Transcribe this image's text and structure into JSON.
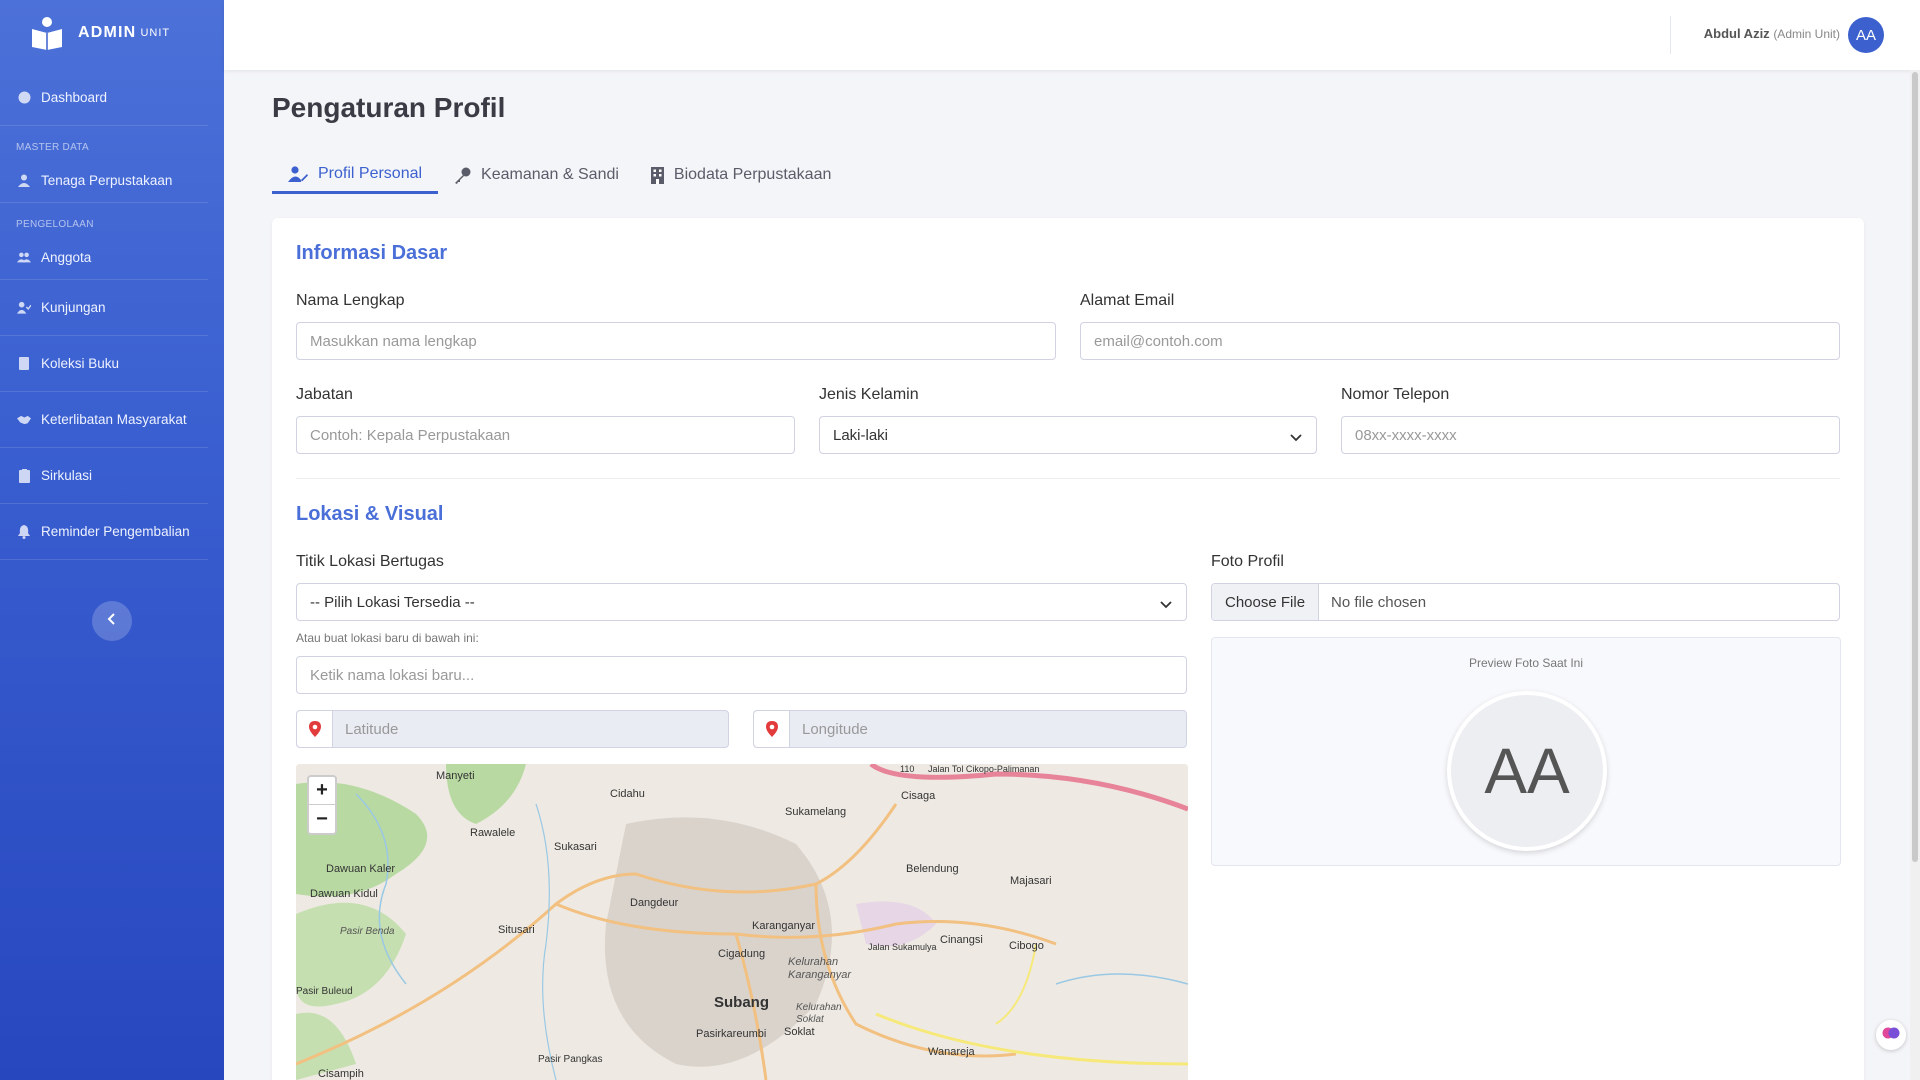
{
  "brand": {
    "name": "ADMIN",
    "sup": "UNIT"
  },
  "sidebar": {
    "dashboard": "Dashboard",
    "heading_master": "MASTER DATA",
    "tenaga": "Tenaga Perpustakaan",
    "heading_pengelolaan": "PENGELOLAAN",
    "items": [
      "Anggota",
      "Kunjungan",
      "Koleksi Buku",
      "Keterlibatan Masyarakat",
      "Sirkulasi",
      "Reminder Pengembalian"
    ]
  },
  "topbar": {
    "user_name": "Abdul Aziz",
    "user_role": "(Admin Unit)",
    "avatar_initials": "AA"
  },
  "page": {
    "title": "Pengaturan Profil"
  },
  "tabs": [
    "Profil Personal",
    "Keamanan & Sandi",
    "Biodata Perpustakaan"
  ],
  "info": {
    "title": "Informasi Dasar",
    "nama_label": "Nama Lengkap",
    "nama_placeholder": "Masukkan nama lengkap",
    "email_label": "Alamat Email",
    "email_placeholder": "email@contoh.com",
    "jabatan_label": "Jabatan",
    "jabatan_placeholder": "Contoh: Kepala Perpustakaan",
    "gender_label": "Jenis Kelamin",
    "gender_value": "Laki-laki",
    "phone_label": "Nomor Telepon",
    "phone_placeholder": "08xx-xxxx-xxxx"
  },
  "lokasi": {
    "title": "Lokasi & Visual",
    "titik_label": "Titik Lokasi Bertugas",
    "select_value": "-- Pilih Lokasi Tersedia --",
    "hint": "Atau buat lokasi baru di bawah ini:",
    "new_placeholder": "Ketik nama lokasi baru...",
    "lat_placeholder": "Latitude",
    "lng_placeholder": "Longitude",
    "foto_label": "Foto Profil",
    "choose_file": "Choose File",
    "no_file": "No file chosen",
    "preview_label": "Preview Foto Saat Ini",
    "preview_initials": "AA"
  },
  "map": {
    "labels": [
      "Manyeti",
      "Cidahu",
      "Sukamelang",
      "Cisaga",
      "Rawalele",
      "Sukasari",
      "Dawuan Kaler",
      "Belendung",
      "Majasari",
      "Dawuan Kidul",
      "Dangdeur",
      "Karanganyar",
      "Situsari",
      "Pasir Benda",
      "Cigadung",
      "Kelurahan Karanganyar",
      "Cinangsi",
      "Cibogo",
      "Jalan Sukamulya",
      "Pasir Buleud",
      "Subang",
      "Kelurahan Soklat",
      "Soklat",
      "Pasirkareumbi",
      "Wanareja",
      "Pasir Pangkas",
      "Cisampih",
      "Jalan Tol Cikopo-Palimanan",
      "110"
    ],
    "zoom_in": "+",
    "zoom_out": "−"
  }
}
